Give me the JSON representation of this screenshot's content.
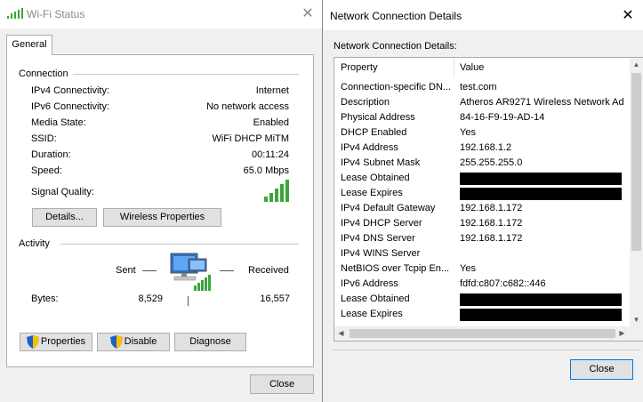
{
  "wifi_status": {
    "title": "Wi-Fi Status",
    "tab": "General",
    "connection": {
      "heading": "Connection",
      "rows": [
        {
          "label": "IPv4 Connectivity:",
          "value": "Internet"
        },
        {
          "label": "IPv6 Connectivity:",
          "value": "No network access"
        },
        {
          "label": "Media State:",
          "value": "Enabled"
        },
        {
          "label": "SSID:",
          "value": "WiFi DHCP MiTM"
        },
        {
          "label": "Duration:",
          "value": "00:11:24"
        },
        {
          "label": "Speed:",
          "value": "65.0 Mbps"
        }
      ],
      "signal_label": "Signal Quality:",
      "signal_bars": 5,
      "details_button": "Details...",
      "wireless_button": "Wireless Properties"
    },
    "activity": {
      "heading": "Activity",
      "sent_label": "Sent",
      "received_label": "Received",
      "bytes_label": "Bytes:",
      "bytes_sent": "8,529",
      "bytes_received": "16,557"
    },
    "buttons": {
      "properties": "Properties",
      "disable": "Disable",
      "diagnose": "Diagnose",
      "close": "Close"
    },
    "accent_color": "#3aa63a"
  },
  "network_details": {
    "title": "Network Connection Details",
    "group_label": "Network Connection Details:",
    "columns": [
      "Property",
      "Value"
    ],
    "rows": [
      {
        "property": "Connection-specific DN...",
        "value": "test.com",
        "redacted": false
      },
      {
        "property": "Description",
        "value": "Atheros AR9271 Wireless Network Ad",
        "redacted": false
      },
      {
        "property": "Physical Address",
        "value": "84-16-F9-19-AD-14",
        "redacted": false
      },
      {
        "property": "DHCP Enabled",
        "value": "Yes",
        "redacted": false
      },
      {
        "property": "IPv4 Address",
        "value": "192.168.1.2",
        "redacted": false
      },
      {
        "property": "IPv4 Subnet Mask",
        "value": "255.255.255.0",
        "redacted": false
      },
      {
        "property": "Lease Obtained",
        "value": "",
        "redacted": true
      },
      {
        "property": "Lease Expires",
        "value": "",
        "redacted": true
      },
      {
        "property": "IPv4 Default Gateway",
        "value": "192.168.1.172",
        "redacted": false
      },
      {
        "property": "IPv4 DHCP Server",
        "value": "192.168.1.172",
        "redacted": false
      },
      {
        "property": "IPv4 DNS Server",
        "value": "192.168.1.172",
        "redacted": false
      },
      {
        "property": "IPv4 WINS Server",
        "value": "",
        "redacted": false
      },
      {
        "property": "NetBIOS over Tcpip En...",
        "value": "Yes",
        "redacted": false
      },
      {
        "property": "IPv6 Address",
        "value": "fdfd:c807:c682::446",
        "redacted": false
      },
      {
        "property": "Lease Obtained",
        "value": "",
        "redacted": true
      },
      {
        "property": "Lease Expires",
        "value": "",
        "redacted": true
      }
    ],
    "close_button": "Close"
  }
}
